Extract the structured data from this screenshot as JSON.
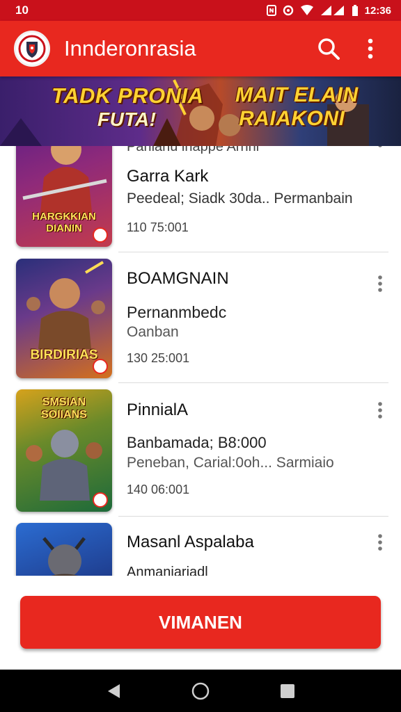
{
  "status_bar": {
    "time_left": "10",
    "time_right": "12:36"
  },
  "app_bar": {
    "title": "Innderonrasia"
  },
  "banner": {
    "line1": "TADK PRONIA",
    "line2": "FUTA!",
    "line3": "MAIT ELAIN",
    "line4": "RAIAKONI"
  },
  "list": {
    "partial_header": "Parilanu inappe Arnhi",
    "items": [
      {
        "title": "Garra Kark",
        "line1": "Peedeal; Siadk 30da.. Permanbain",
        "line2": "",
        "stat": "110 75:001",
        "thumb_text": "HARGKKIAN DIANIN",
        "thumb_colors": [
          "#5b1e86",
          "#c23b4c"
        ]
      },
      {
        "title": "BOAMGNAIN",
        "line1": "Pernanmbedc",
        "line2": "Oanban",
        "stat": "130 25:001",
        "thumb_text": "BIRDIRIAS",
        "thumb_colors": [
          "#2a2f7a",
          "#d4701c"
        ]
      },
      {
        "title": "PinnialA",
        "line1": "Banbamada; B8:000",
        "line2": "Peneban, Carial:0oh... Sarmiaio",
        "stat": "140 06:001",
        "thumb_text": "SMSIAN SOIIANS",
        "thumb_colors": [
          "#1d6a3a",
          "#d6a21c"
        ]
      },
      {
        "title": "Masanl Aspalaba",
        "line1": "Anmaniariadl",
        "line2": "",
        "stat": "",
        "thumb_text": "",
        "thumb_colors": [
          "#1e3a8a",
          "#2b6cd1"
        ]
      }
    ]
  },
  "cta": {
    "label": "VIMANEN"
  },
  "colors": {
    "primary": "#e8281f",
    "status": "#c9111b"
  }
}
